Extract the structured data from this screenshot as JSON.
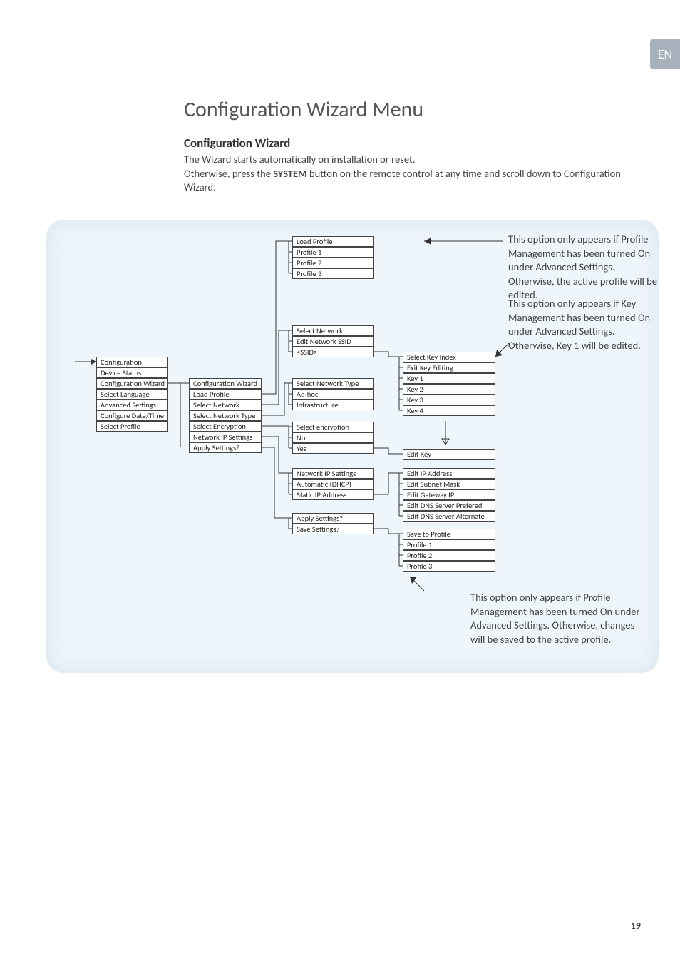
{
  "lang_tab": "EN",
  "title": "Configuration Wizard Menu",
  "subtitle": "Configuration Wizard",
  "intro_line1": "The Wizard starts automatically on installation or reset.",
  "intro_line2a": "Otherwise, press the ",
  "intro_line2b": "SYSTEM",
  "intro_line2c": " button on the remote control at any time and scroll down to Configuration Wizard.",
  "col1": {
    "configuration": "Configuration",
    "device_status": "Device Status",
    "config_wizard": "Configuration Wizard",
    "select_language": "Select Language",
    "advanced_settings": "Advanced Settings",
    "configure_datetime": "Configure Date/Time",
    "select_profile": "Select Profile"
  },
  "col2": {
    "config_wizard": "Configuration Wizard",
    "load_profile": "Load Profile",
    "select_network": "Select Network",
    "select_network_type": "Select Network Type",
    "select_encryption": "Select Encryption",
    "network_ip_settings": "Network IP Settings",
    "apply_settings": "Apply Settings?"
  },
  "col3": {
    "load_profile": "Load Profile",
    "profile1": "Profile 1",
    "profile2": "Profile 2",
    "profile3": "Profile 3",
    "select_network": "Select Network",
    "edit_network_ssid": "Edit Network SSID",
    "ssid": "<SSID>",
    "select_network_type": "Select Network Type",
    "ad_hoc": "Ad-hoc",
    "infrastructure": "Infrastructure",
    "select_encryption": "Select encryption",
    "no": "No",
    "yes": "Yes",
    "network_ip_settings": "Network IP Settings",
    "automatic_dhcp": "Automatic (DHCP)",
    "static_ip": "Static IP Address",
    "apply_settings": "Apply Settings?",
    "save_settings": "Save Settings?"
  },
  "col4": {
    "select_key_index": "Select Key Index",
    "exit_key_editing": "Exit Key Editing",
    "key1": "Key 1",
    "key2": "Key 2",
    "key3": "Key 3",
    "key4": "Key 4",
    "edit_key": "Edit Key",
    "edit_ip_address": "Edit IP Address",
    "edit_subnet_mask": "Edit Subnet Mask",
    "edit_gateway_ip": "Edit Gateway IP",
    "edit_dns_prefered": "Edit DNS Server Prefered",
    "edit_dns_alternate": "Edit DNS Server Alternate",
    "save_to_profile": "Save to Profile",
    "profile1": "Profile 1",
    "profile2": "Profile 2",
    "profile3": "Profile 3"
  },
  "annotations": {
    "a1": "This option only appears if Profile Management has been turned On under Advanced Settings. Otherwise, the active profile will be edited.",
    "a2": "This option only appears if Key Management has been turned On under Advanced Settings.",
    "a2b": "Otherwise, Key 1 will be edited.",
    "a3": "This option only appears if Profile Management has been turned On under Advanced Settings. Otherwise, changes will be saved to the active profile."
  },
  "page_number": "19"
}
